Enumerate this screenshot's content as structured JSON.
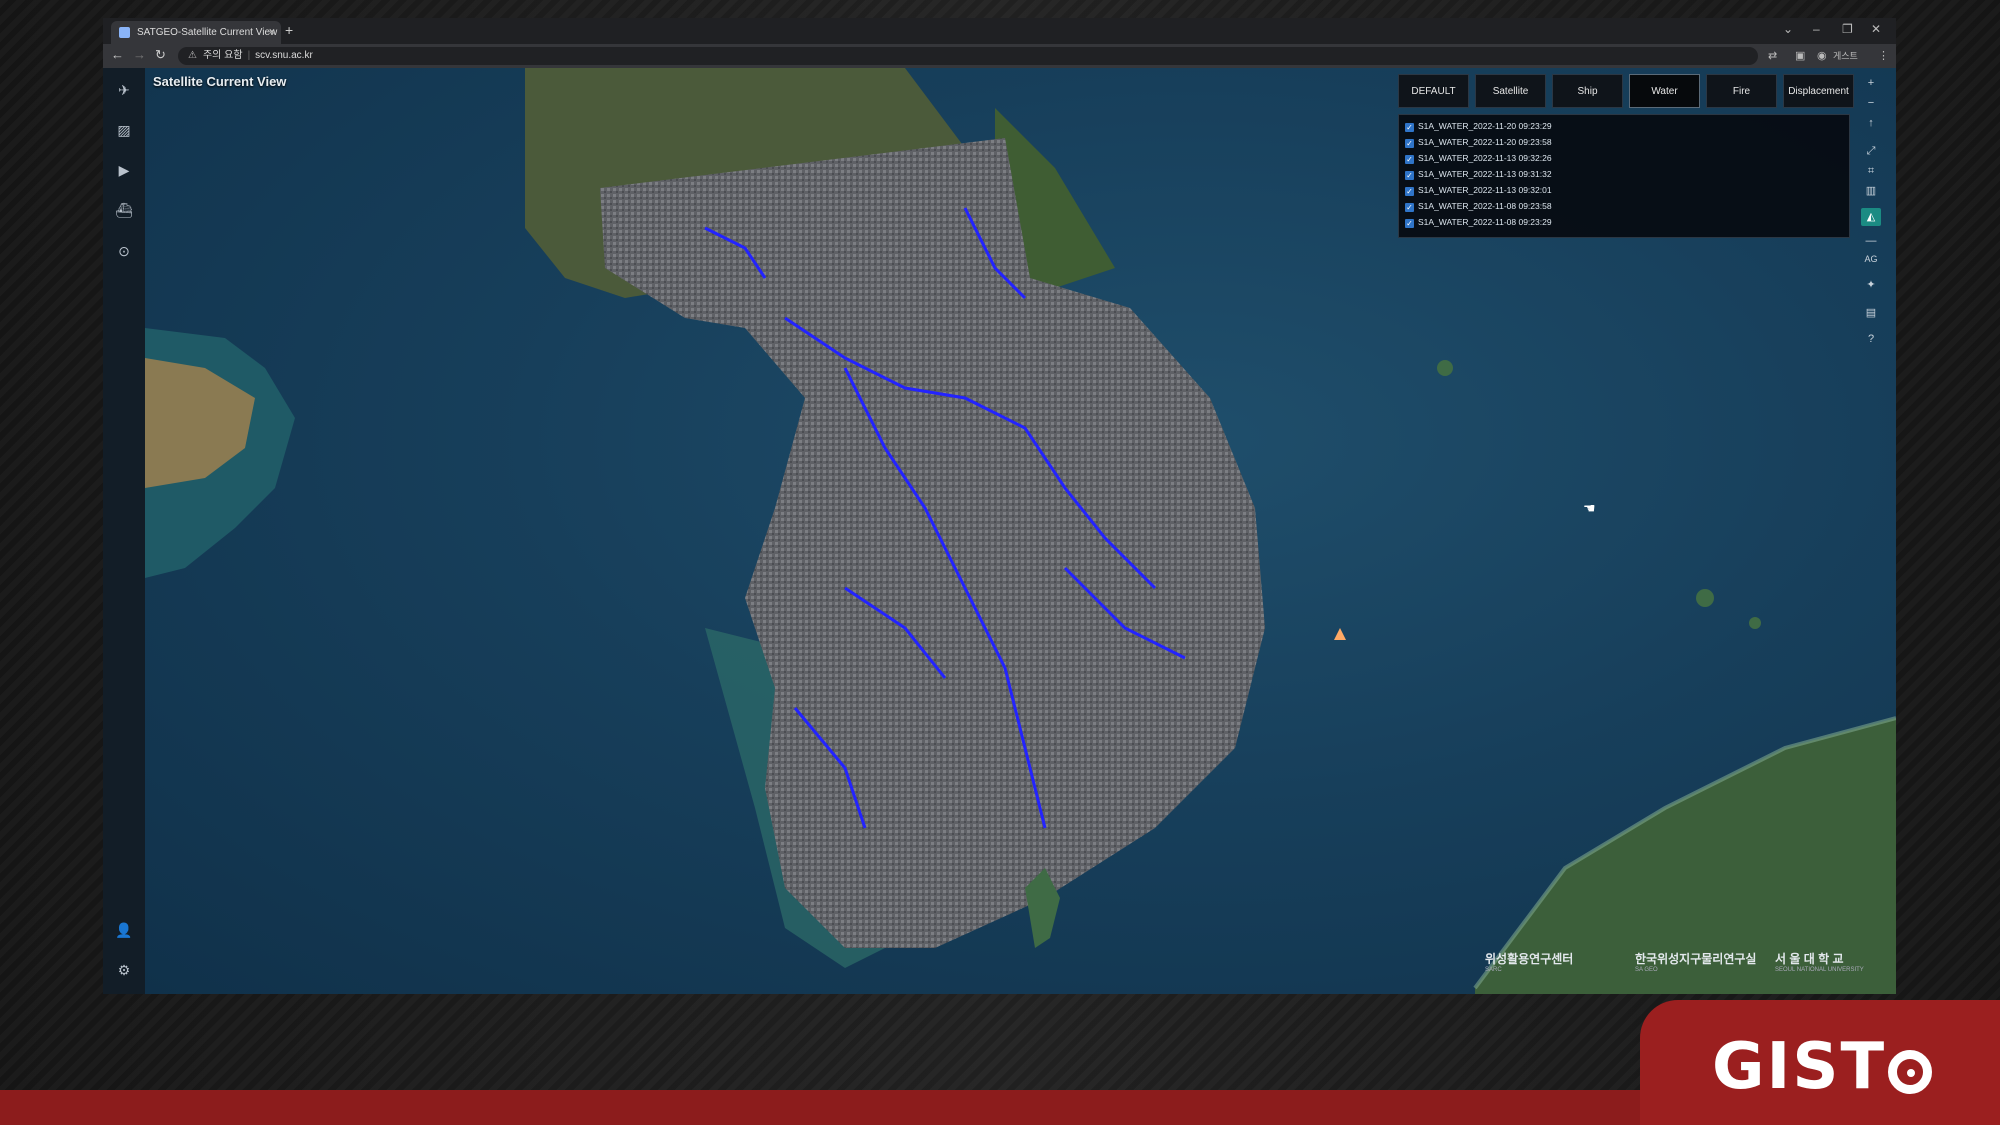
{
  "browser": {
    "tab_title": "SATGEO-Satellite Current View",
    "tab_close": "×",
    "new_tab": "+",
    "url_warning": "주의 요함",
    "url": "scv.snu.ac.kr",
    "profile_label": "게스트",
    "window_controls": [
      "⌄",
      "–",
      "❐",
      "✕"
    ]
  },
  "map": {
    "title": "Satellite Current View"
  },
  "layer_tabs": [
    "DEFAULT",
    "Satellite",
    "Ship",
    "Water",
    "Fire",
    "Displacement"
  ],
  "active_layer_tab": "Water",
  "layers": [
    "S1A_WATER_2022-11-20 09:23:29",
    "S1A_WATER_2022-11-20 09:23:58",
    "S1A_WATER_2022-11-13 09:32:26",
    "S1A_WATER_2022-11-13 09:31:32",
    "S1A_WATER_2022-11-13 09:32:01",
    "S1A_WATER_2022-11-08 09:23:58",
    "S1A_WATER_2022-11-08 09:23:29"
  ],
  "map_tools": [
    "+",
    "−",
    "↑",
    "⤢",
    "⌗",
    "▥",
    "◭",
    "—",
    "AG",
    "✦",
    "▤",
    "?"
  ],
  "footer_logos": {
    "sarc": "위성활용연구센터",
    "sarc_small": "SARC",
    "satgeo": "한국위성지구물리연구실",
    "satgeo_small": "SA GEO",
    "snu": "서 울 대 학 교",
    "snu_small": "SEOUL NATIONAL UNIVERSITY"
  },
  "brand": {
    "text": "GIST"
  },
  "colors": {
    "sea": "#173f5b",
    "sar_overlay": "#6b6e73",
    "water_detection": "#2222ff",
    "brand_red": "#9b1f1f"
  }
}
